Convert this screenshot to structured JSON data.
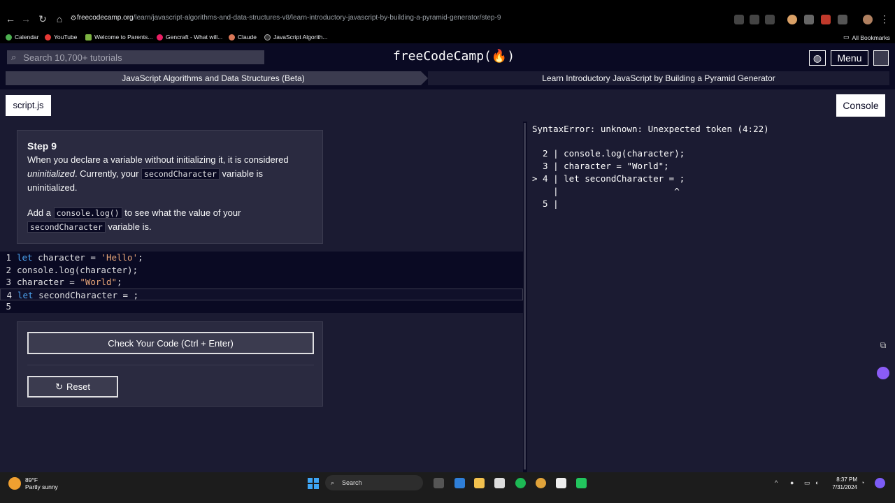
{
  "browser": {
    "url_host": "freecodecamp.org",
    "url_path": "/learn/javascript-algorithms-and-data-structures-v8/learn-introductory-javascript-by-building-a-pyramid-generator/step-9",
    "bookmarks": [
      "Calendar",
      "YouTube",
      "Welcome to Parents...",
      "Gencraft - What will...",
      "Claude",
      "JavaScript Algorith..."
    ],
    "all_bookmarks": "All Bookmarks"
  },
  "header": {
    "search_placeholder": "Search 10,700+ tutorials",
    "logo": "freeCodeCamp(🔥)",
    "menu_label": "Menu"
  },
  "breadcrumb": {
    "superblock": "JavaScript Algorithms and Data Structures (Beta)",
    "block": "Learn Introductory JavaScript by Building a Pyramid Generator"
  },
  "tabs": {
    "file": "script.js",
    "console": "Console"
  },
  "instructions": {
    "title": "Step 9",
    "p1_a": "When you declare a variable without initializing it, it is considered ",
    "p1_em": "uninitialized",
    "p1_b": ". Currently, your ",
    "p1_code": "secondCharacter",
    "p1_c": " variable is uninitialized.",
    "p2_a": "Add a ",
    "p2_code1": "console.log()",
    "p2_b": " to see what the value of your ",
    "p2_code2": "secondCharacter",
    "p2_c": " variable is."
  },
  "editor": {
    "lines": [
      {
        "num": "1",
        "kw": "let",
        "rest": " character = ",
        "str": "'Hello'",
        "end": ";"
      },
      {
        "num": "2",
        "kw": "",
        "rest": "console.log(character);",
        "str": "",
        "end": ""
      },
      {
        "num": "3",
        "kw": "",
        "rest": "character = ",
        "str": "\"World\"",
        "end": ";"
      },
      {
        "num": "4",
        "kw": "let",
        "rest": " secondCharacter = ;",
        "str": "",
        "end": ""
      },
      {
        "num": "5",
        "kw": "",
        "rest": "",
        "str": "",
        "end": ""
      }
    ]
  },
  "actions": {
    "check": "Check Your Code (Ctrl + Enter)",
    "reset": "Reset"
  },
  "console": {
    "lines": [
      "SyntaxError: unknown: Unexpected token (4:22)",
      "",
      "  2 | console.log(character);",
      "  3 | character = \"World\";",
      "> 4 | let secondCharacter = ;",
      "    |                      ^",
      "  5 |"
    ]
  },
  "taskbar": {
    "temp": "89°F",
    "weather": "Partly sunny",
    "search": "Search",
    "time": "8:37 PM",
    "date": "7/31/2024"
  }
}
